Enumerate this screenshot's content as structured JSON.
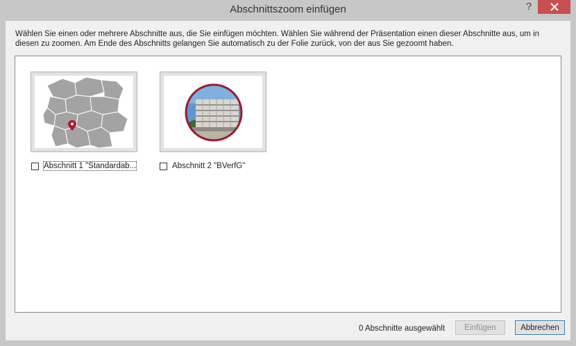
{
  "window": {
    "title": "Abschnittszoom einfügen",
    "help_label": "?"
  },
  "description": "Wählen Sie einen oder mehrere Abschnitte aus, die Sie einfügen möchten. Wählen Sie während der Präsentation einen dieser Abschnitte aus, um in diesen zu zoomen. Am Ende des Abschnitts gelangen Sie automatisch zu der Folie zurück, von der aus Sie gezoomt haben.",
  "sections": [
    {
      "label": "Abschnitt 1 \"Standardab...",
      "checked": false,
      "thumbnail": "germany-map"
    },
    {
      "label": "Abschnitt 2 \"BVerfG\"",
      "checked": false,
      "thumbnail": "building-photo-circle"
    }
  ],
  "footer": {
    "status": "0 Abschnitte ausgewählt",
    "insert_label": "Einfügen",
    "cancel_label": "Abbrechen"
  },
  "colors": {
    "close_button": "#c74f50",
    "map_marker": "#b0162d",
    "photo_ring": "#9b1b30"
  }
}
